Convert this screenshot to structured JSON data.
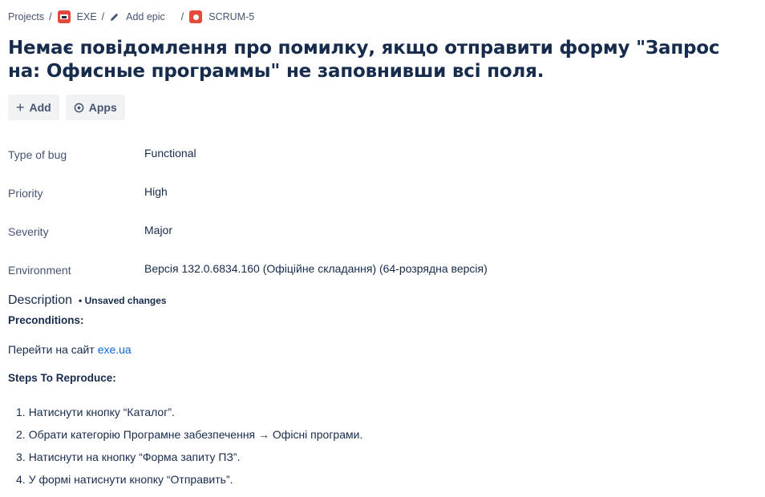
{
  "breadcrumb": {
    "projects": "Projects",
    "project": "EXE",
    "epic": "Add epic",
    "issue": "SCRUM-5"
  },
  "issue": {
    "title": "Немає повідомлення про помилку, якщо отправити форму \"Запрос на: Офисные программы\" не заповнивши всі поля."
  },
  "actions": {
    "add": "Add",
    "apps": "Apps"
  },
  "fields": [
    {
      "label": "Type of bug",
      "value": "Functional"
    },
    {
      "label": "Priority",
      "value": "High"
    },
    {
      "label": "Severity",
      "value": "Major"
    },
    {
      "label": "Environment",
      "value": "Версія 132.0.6834.160 (Офіційне складання) (64-розрядна версія)"
    }
  ],
  "description": {
    "title": "Description",
    "unsaved": "• Unsaved changes",
    "preconditions_heading": "Preconditions:",
    "precondition_text": "Перейти на сайт ",
    "precondition_link": "exe.ua",
    "steps_heading": "Steps To Reproduce:",
    "steps": [
      {
        "num": "1.",
        "text": "Натиснути кнопку “Каталог”."
      },
      {
        "num": "2.",
        "text": "Обрати категорію Програмне забезпечення → Офісні програми."
      },
      {
        "num": "3.",
        "text": "Натиснути на кнопку “Форма запиту ПЗ”."
      },
      {
        "num": "4.",
        "text": "У формі натиснути кнопку “Отправить”."
      }
    ]
  },
  "colors": {
    "text": "#172b4d",
    "subtle": "#44546f",
    "link": "#0c66e4",
    "button_bg": "#f1f2f4",
    "bug_icon": "#e5493a"
  },
  "icons": {
    "project": "project-avatar-icon",
    "epic": "pencil-icon",
    "issue_type": "bug-icon",
    "add": "plus-icon",
    "apps": "apps-icon"
  }
}
